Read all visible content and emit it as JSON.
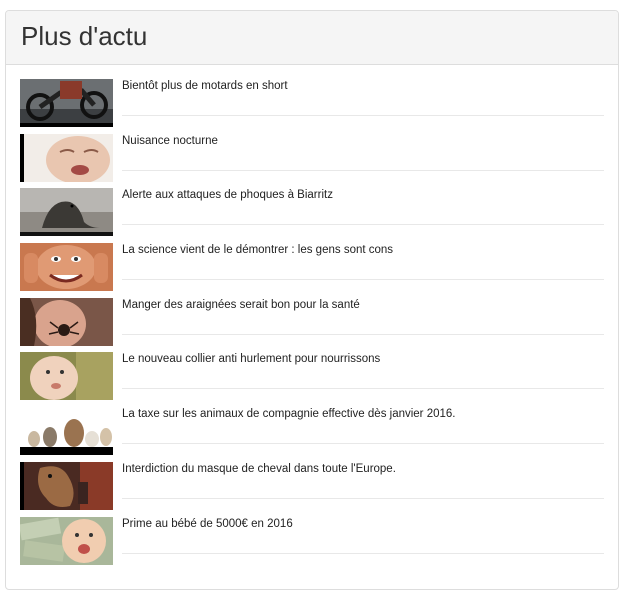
{
  "panel": {
    "title": "Plus d'actu"
  },
  "articles": [
    {
      "title": "Bientôt plus de motards en short",
      "thumb": "motorcycle-thumb"
    },
    {
      "title": "Nuisance nocturne",
      "thumb": "crying-baby-thumb"
    },
    {
      "title": "Alerte aux attaques de phoques à Biarritz",
      "thumb": "seal-thumb"
    },
    {
      "title": "La science vient de le démontrer : les gens sont cons",
      "thumb": "funny-face-thumb"
    },
    {
      "title": "Manger des araignées serait bon pour la santé",
      "thumb": "woman-eating-spider-thumb"
    },
    {
      "title": "Le nouveau collier anti hurlement pour nourrissons",
      "thumb": "baby-pacifier-thumb"
    },
    {
      "title": "La taxe sur les animaux de compagnie effective dès janvier 2016.",
      "thumb": "pets-thumb"
    },
    {
      "title": "Interdiction du masque de cheval dans toute l'Europe.",
      "thumb": "horse-mask-thumb"
    },
    {
      "title": "Prime au bébé de 5000€ en 2016",
      "thumb": "baby-money-thumb"
    }
  ]
}
